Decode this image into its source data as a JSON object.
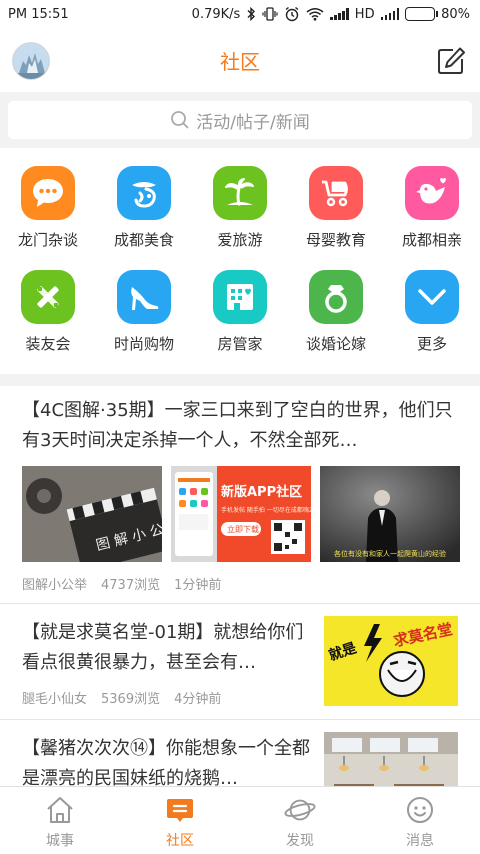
{
  "status_bar": {
    "time": "PM 15:51",
    "net_speed": "0.79K/s",
    "network": "HD",
    "battery": "80%",
    "battery_level": 0.8
  },
  "header": {
    "title": "社区",
    "avatar_icon": "user-avatar",
    "edit_icon": "edit-icon"
  },
  "search": {
    "placeholder": "活动/帖子/新闻",
    "icon": "search-icon"
  },
  "categories": [
    {
      "label": "龙门杂谈",
      "icon": "chat-bubble-icon",
      "color": "#ff8a1f"
    },
    {
      "label": "成都美食",
      "icon": "food-icon",
      "color": "#29a6f2"
    },
    {
      "label": "爱旅游",
      "icon": "palm-tree-icon",
      "color": "#6cc21f"
    },
    {
      "label": "母婴教育",
      "icon": "stroller-icon",
      "color": "#ff5b5b"
    },
    {
      "label": "成都相亲",
      "icon": "bird-heart-icon",
      "color": "#ff5aa0"
    },
    {
      "label": "装友会",
      "icon": "tools-icon",
      "color": "#6cc21f"
    },
    {
      "label": "时尚购物",
      "icon": "high-heel-icon",
      "color": "#29a6f2"
    },
    {
      "label": "房管家",
      "icon": "building-heart-icon",
      "color": "#19c9c3"
    },
    {
      "label": "谈婚论嫁",
      "icon": "ring-icon",
      "color": "#4cb64c"
    },
    {
      "label": "更多",
      "icon": "chevron-down-icon",
      "color": "#29a6f2"
    }
  ],
  "posts": [
    {
      "title": "【4C图解·35期】一家三口来到了空白的世界，他们只有3天时间决定杀掉一个人，不然全部死…",
      "author": "图解小公举",
      "views": "4737浏览",
      "time": "1分钟前",
      "images": [
        {
          "caption": "图 解 小 公"
        },
        {
          "caption_main": "新版APP社区",
          "caption_sub": "手机发帖 随手拍 一切尽在成都嗨2.0",
          "button": "立即下载"
        },
        {
          "caption": "各位有没有和家人一起爬黄山的经验"
        }
      ]
    },
    {
      "title": "【就是求莫名堂-01期】就想给你们看点很黄很暴力，甚至会有…",
      "author": "腿毛小仙女",
      "views": "5369浏览",
      "time": "4分钟前",
      "image_text": [
        "就是",
        "求莫名堂"
      ]
    },
    {
      "title": "【馨猪次次次⑭】你能想象一个全都是漂亮的民国妹纸的烧鹅…"
    }
  ],
  "tabs": [
    {
      "label": "城事",
      "icon": "home-icon"
    },
    {
      "label": "社区",
      "icon": "community-icon",
      "active": true
    },
    {
      "label": "发现",
      "icon": "planet-icon"
    },
    {
      "label": "消息",
      "icon": "smile-icon"
    }
  ],
  "colors": {
    "accent": "#f37b1d",
    "text": "#333333",
    "muted": "#999999",
    "bg": "#f2f2f2"
  }
}
